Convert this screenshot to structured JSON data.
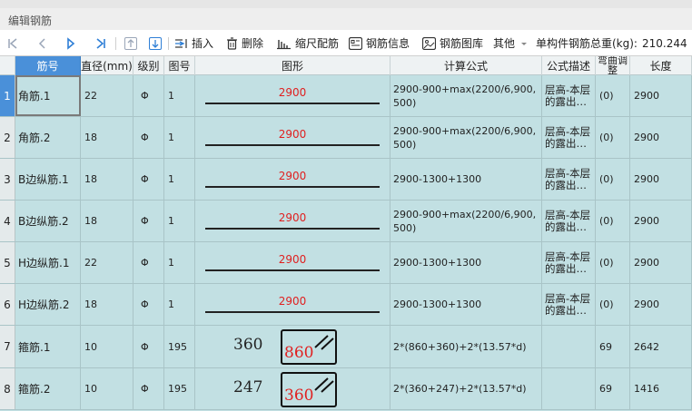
{
  "window": {
    "title": "编辑钢筋"
  },
  "toolbar": {
    "insert": "插入",
    "delete": "删除",
    "scale": "缩尺配筋",
    "info": "钢筋信息",
    "library": "钢筋图库",
    "other": "其他",
    "weight_label": "单构件钢筋总重(kg):",
    "weight_value": "210.244"
  },
  "columns": {
    "name": "筋号",
    "diameter": "直径(mm)",
    "grade": "级别",
    "figno": "图号",
    "shape": "图形",
    "formula": "计算公式",
    "desc": "公式描述",
    "bend": "弯曲调整",
    "length": "长度"
  },
  "grade_symbol": "Φ",
  "rows": [
    {
      "no": "1",
      "name": "角筋.1",
      "diameter": "22",
      "grade": "Φ",
      "figno": "1",
      "shape": "straight",
      "shape_value": "2900",
      "formula": "2900-900+max(2200/6,900,500)",
      "desc": "层高-本层的露出…",
      "bend": "(0)",
      "length": "2900"
    },
    {
      "no": "2",
      "name": "角筋.2",
      "diameter": "18",
      "grade": "Φ",
      "figno": "1",
      "shape": "straight",
      "shape_value": "2900",
      "formula": "2900-900+max(2200/6,900,500)",
      "desc": "层高-本层的露出…",
      "bend": "(0)",
      "length": "2900"
    },
    {
      "no": "3",
      "name": "B边纵筋.1",
      "diameter": "18",
      "grade": "Φ",
      "figno": "1",
      "shape": "straight",
      "shape_value": "2900",
      "formula": "2900-1300+1300",
      "desc": "层高-本层的露出…",
      "bend": "(0)",
      "length": "2900"
    },
    {
      "no": "4",
      "name": "B边纵筋.2",
      "diameter": "18",
      "grade": "Φ",
      "figno": "1",
      "shape": "straight",
      "shape_value": "2900",
      "formula": "2900-900+max(2200/6,900,500)",
      "desc": "层高-本层的露出…",
      "bend": "(0)",
      "length": "2900"
    },
    {
      "no": "5",
      "name": "H边纵筋.1",
      "diameter": "22",
      "grade": "Φ",
      "figno": "1",
      "shape": "straight",
      "shape_value": "2900",
      "formula": "2900-1300+1300",
      "desc": "层高-本层的露出…",
      "bend": "(0)",
      "length": "2900"
    },
    {
      "no": "6",
      "name": "H边纵筋.2",
      "diameter": "18",
      "grade": "Φ",
      "figno": "1",
      "shape": "straight",
      "shape_value": "2900",
      "formula": "2900-1300+1300",
      "desc": "层高-本层的露出…",
      "bend": "(0)",
      "length": "2900"
    },
    {
      "no": "7",
      "name": "箍筋.1",
      "diameter": "10",
      "grade": "Φ",
      "figno": "195",
      "shape": "stirrup",
      "shape_width": "360",
      "shape_height": "860",
      "formula": "2*(860+360)+2*(13.57*d)",
      "desc": "",
      "bend": "69",
      "length": "2642"
    },
    {
      "no": "8",
      "name": "箍筋.2",
      "diameter": "10",
      "grade": "Φ",
      "figno": "195",
      "shape": "stirrup",
      "shape_width": "247",
      "shape_height": "360",
      "formula": "2*(360+247)+2*(13.57*d)",
      "desc": "",
      "bend": "69",
      "length": "1416"
    }
  ]
}
